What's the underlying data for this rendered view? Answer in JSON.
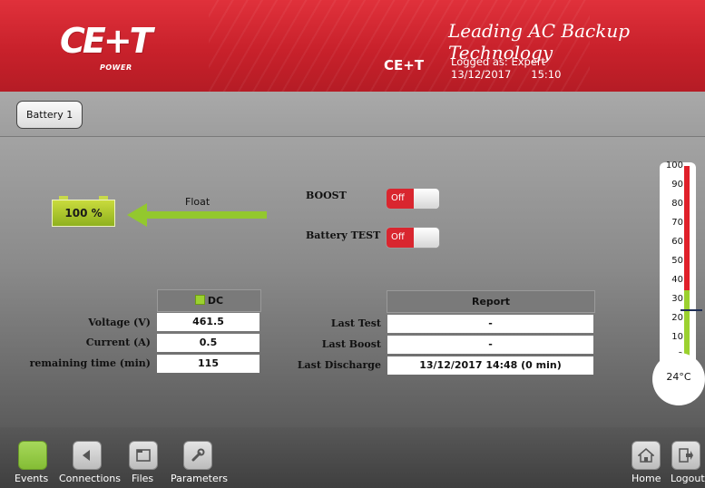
{
  "header": {
    "logo_text": "CE+T",
    "logo_sub": "POWER",
    "tagline": "Leading AC Backup Technology",
    "brand": "CE+T",
    "logged_as": "Logged as: Expert",
    "date": "13/12/2017",
    "time": "15:10"
  },
  "tabs": [
    {
      "label": "Battery 1"
    }
  ],
  "battery": {
    "level": "100 %",
    "state": "Float"
  },
  "controls": {
    "boost": {
      "label": "BOOST",
      "value": "Off"
    },
    "battery_test": {
      "label": "Battery TEST",
      "value": "Off"
    }
  },
  "dc_table": {
    "header": "DC",
    "rows": [
      {
        "label": "Voltage (V)",
        "value": "461.5"
      },
      {
        "label": "Current (A)",
        "value": "0.5"
      },
      {
        "label": "remaining time (min)",
        "value": "115"
      }
    ]
  },
  "report_table": {
    "header": "Report",
    "rows": [
      {
        "label": "Last Test",
        "value": "-"
      },
      {
        "label": "Last Boost",
        "value": "-"
      },
      {
        "label": "Last Discharge",
        "value": "13/12/2017 14:48 (0 min)"
      }
    ]
  },
  "thermometer": {
    "ticks": [
      "100",
      "90",
      "80",
      "70",
      "60",
      "50",
      "40",
      "30",
      "20",
      "10",
      "0"
    ],
    "current_value": 24,
    "current_label": "24°C",
    "colors": {
      "high": "#e0202a",
      "low": "#9bd12f"
    }
  },
  "footer": {
    "items": [
      {
        "label": "Events",
        "icon": "events-icon"
      },
      {
        "label": "Connections",
        "icon": "connections-icon"
      },
      {
        "label": "Files",
        "icon": "files-icon"
      },
      {
        "label": "Parameters",
        "icon": "wrench-icon"
      },
      {
        "label": "Home",
        "icon": "home-icon"
      },
      {
        "label": "Logout",
        "icon": "logout-icon"
      }
    ]
  }
}
